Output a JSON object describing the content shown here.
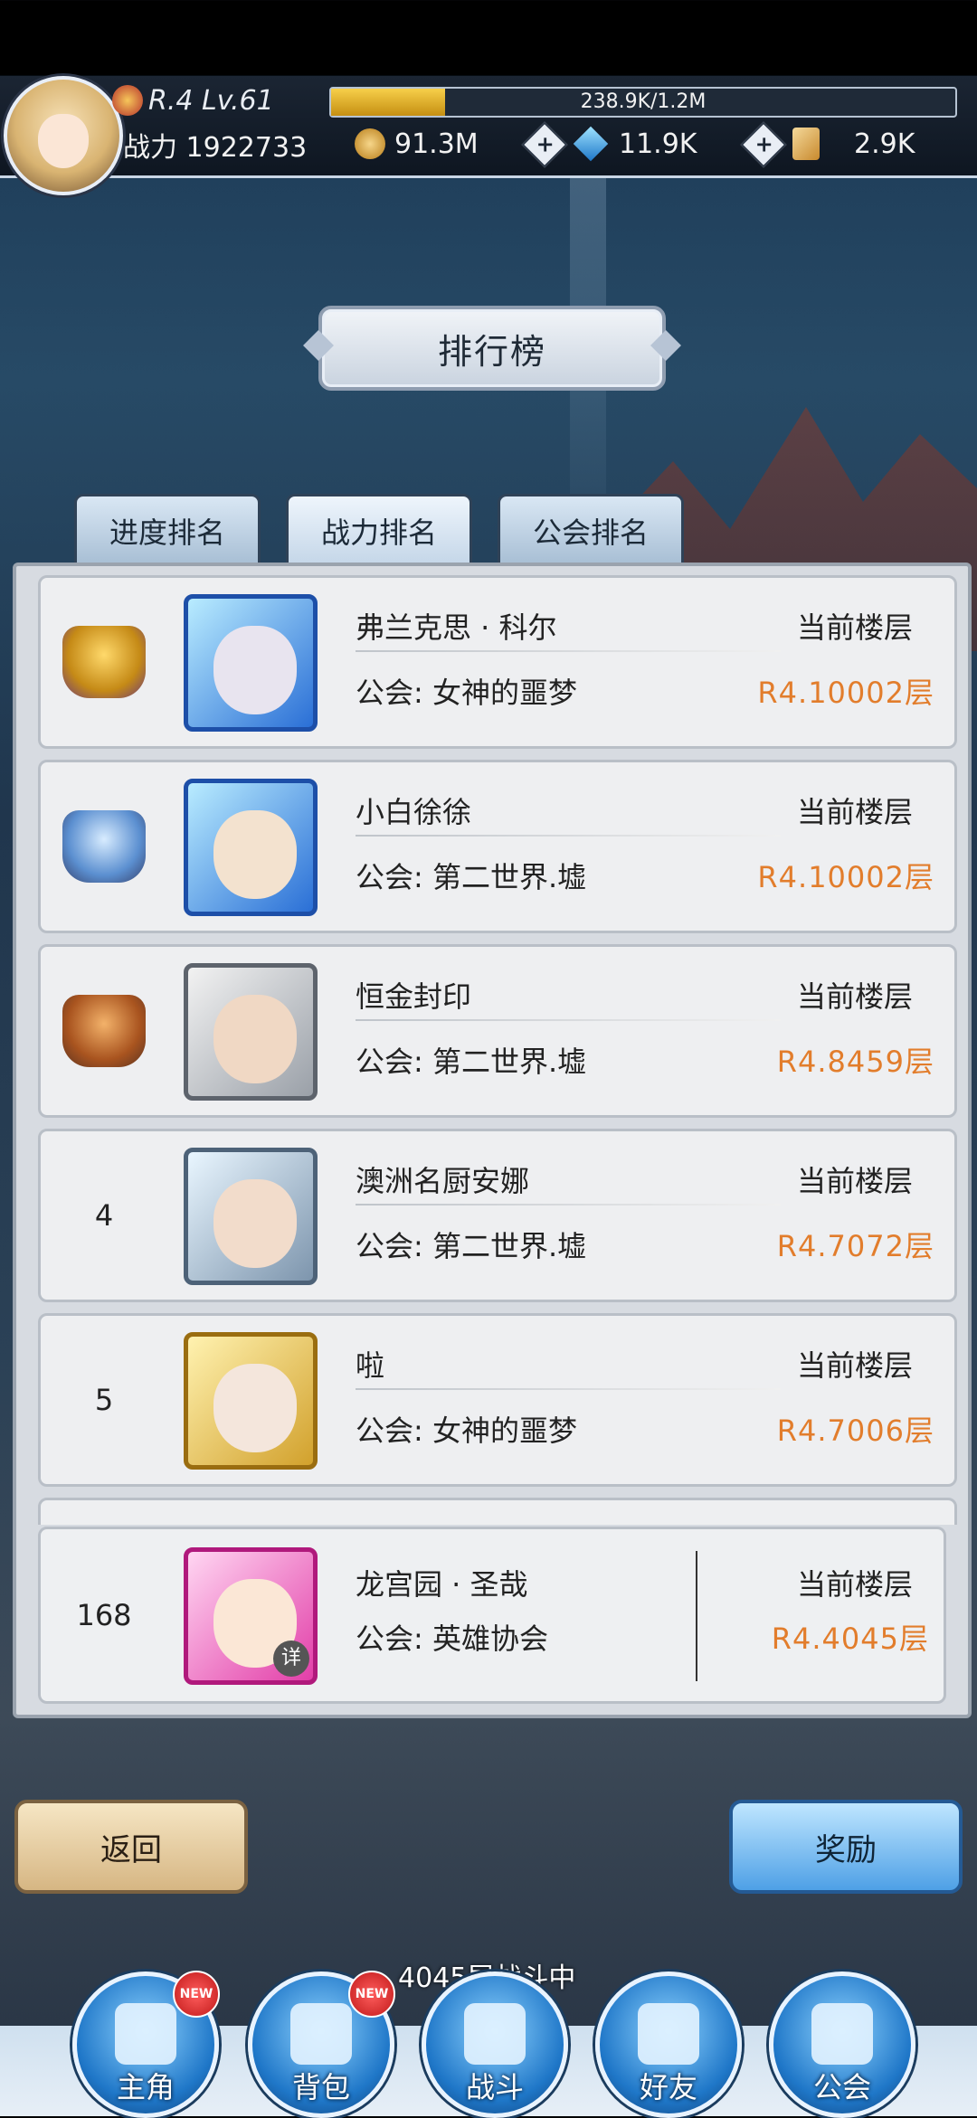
{
  "header": {
    "level": "R.4 Lv.61",
    "exp": "238.9K/1.2M",
    "exp_ratio": 0.183,
    "power_label": "战力",
    "power_value": "1922733",
    "gold": "91.3M",
    "gems": "11.9K",
    "scrolls": "2.9K"
  },
  "title": "排行榜",
  "tabs": [
    "进度排名",
    "战力排名",
    "公会排名"
  ],
  "floor_label": "当前楼层",
  "entries": [
    {
      "rank": "",
      "trophy": "gold",
      "name": "弗兰克思 · 科尔",
      "guild": "公会: 女神的噩梦",
      "floor": "R4.10002层"
    },
    {
      "rank": "",
      "trophy": "silver",
      "name": "小白徐徐",
      "guild": "公会: 第二世界.墟",
      "floor": "R4.10002层"
    },
    {
      "rank": "",
      "trophy": "bronze",
      "name": "恒金封印",
      "guild": "公会: 第二世界.墟",
      "floor": "R4.8459层"
    },
    {
      "rank": "4",
      "trophy": "",
      "name": "澳洲名厨安娜",
      "guild": "公会: 第二世界.墟",
      "floor": "R4.7072层"
    },
    {
      "rank": "5",
      "trophy": "",
      "name": "啦",
      "guild": "公会: 女神的噩梦",
      "floor": "R4.7006层"
    }
  ],
  "me": {
    "rank": "168",
    "name": "龙宫园 · 圣哉",
    "guild": "公会: 英雄协会",
    "floor": "R4.4045层",
    "detail": "详"
  },
  "buttons": {
    "back": "返回",
    "reward": "奖励"
  },
  "battle_status": "4045层战斗中",
  "nav": [
    {
      "label": "主角",
      "new": "NEW"
    },
    {
      "label": "背包",
      "new": "NEW"
    },
    {
      "label": "战斗",
      "new": ""
    },
    {
      "label": "好友",
      "new": ""
    },
    {
      "label": "公会",
      "new": ""
    }
  ]
}
